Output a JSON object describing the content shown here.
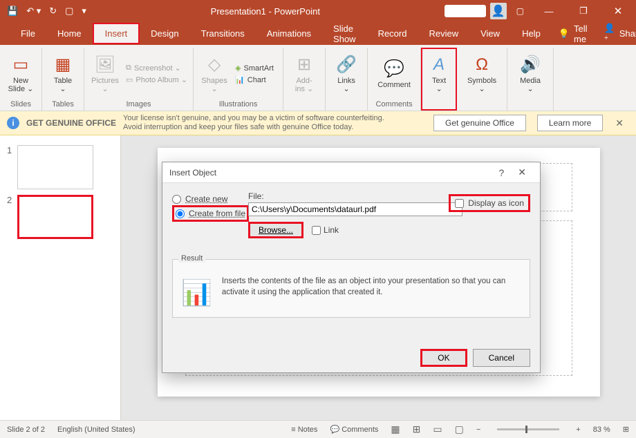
{
  "titlebar": {
    "title": "Presentation1 - PowerPoint"
  },
  "window_controls": {
    "minimize": "—",
    "restore": "❐",
    "close": "✕"
  },
  "tabs": {
    "file": "File",
    "home": "Home",
    "insert": "Insert",
    "design": "Design",
    "transitions": "Transitions",
    "animations": "Animations",
    "slideshow": "Slide Show",
    "record": "Record",
    "review": "Review",
    "view": "View",
    "help": "Help",
    "tellme": "Tell me",
    "share": "Share"
  },
  "ribbon": {
    "new_slide": "New\nSlide ⌄",
    "slides_group": "Slides",
    "table": "Table\n⌄",
    "tables_group": "Tables",
    "pictures": "Pictures\n⌄",
    "screenshot": "Screenshot ⌄",
    "photo_album": "Photo Album ⌄",
    "images_group": "Images",
    "shapes": "Shapes\n⌄",
    "smartart": "SmartArt",
    "chart": "Chart",
    "illustrations_group": "Illustrations",
    "addins": "Add-\nins ⌄",
    "links": "Links\n⌄",
    "comment": "Comment",
    "comments_group": "Comments",
    "text": "Text\n⌄",
    "symbols": "Symbols\n⌄",
    "media": "Media\n⌄"
  },
  "warning": {
    "title": "GET GENUINE OFFICE",
    "msg1": "Your license isn't genuine, and you may be a victim of software counterfeiting.",
    "msg2": "Avoid interruption and keep your files safe with genuine Office today.",
    "btn_get": "Get genuine Office",
    "btn_learn": "Learn more"
  },
  "thumbs": {
    "n1": "1",
    "n2": "2"
  },
  "dialog": {
    "title": "Insert Object",
    "help": "?",
    "close": "✕",
    "create_new": "Create new",
    "create_file": "Create from file",
    "file_label": "File:",
    "file_path": "C:\\Users\\y\\Documents\\dataurl.pdf",
    "browse": "Browse...",
    "link": "Link",
    "display_icon": "Display as icon",
    "result_label": "Result",
    "result_text": "Inserts the contents of the file as an object into your presentation so that you can activate it using the application that created it.",
    "ok": "OK",
    "cancel": "Cancel"
  },
  "status": {
    "slide": "Slide 2 of 2",
    "lang": "English (United States)",
    "notes": "Notes",
    "comments": "Comments",
    "zoom_pct": "83 %",
    "fit": "⊞"
  }
}
